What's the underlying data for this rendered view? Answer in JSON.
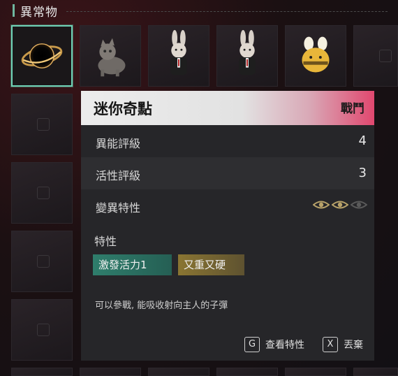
{
  "header": {
    "title": "異常物"
  },
  "panel": {
    "title": "迷你奇點",
    "tag": "戰鬥",
    "rows": [
      {
        "label": "異能評級",
        "value": "4"
      },
      {
        "label": "活性評級",
        "value": "3"
      },
      {
        "label": "變異特性",
        "value": ""
      }
    ],
    "mutation_level": {
      "filled": 2,
      "total": 3
    },
    "traits_label": "特性",
    "traits": [
      {
        "label": "激發活力1",
        "color": "#2f7e6c"
      },
      {
        "label": "又重又硬",
        "color": "#8a7532"
      }
    ],
    "description": "可以參戰, 能吸收射向主人的子彈"
  },
  "footer": {
    "actions": [
      {
        "key": "G",
        "label": "查看特性"
      },
      {
        "key": "X",
        "label": "丟棄"
      }
    ]
  },
  "colors": {
    "accent": "#6fd1b5",
    "tag_pink": "#e0486f",
    "eye_active": "#b9a36a",
    "eye_inactive": "#5a5a5a"
  },
  "inventory": {
    "items": [
      "mini-singularity-icon",
      "cat-icon",
      "rabbit-icon",
      "rabbit-icon",
      "bee-plush-icon"
    ]
  }
}
